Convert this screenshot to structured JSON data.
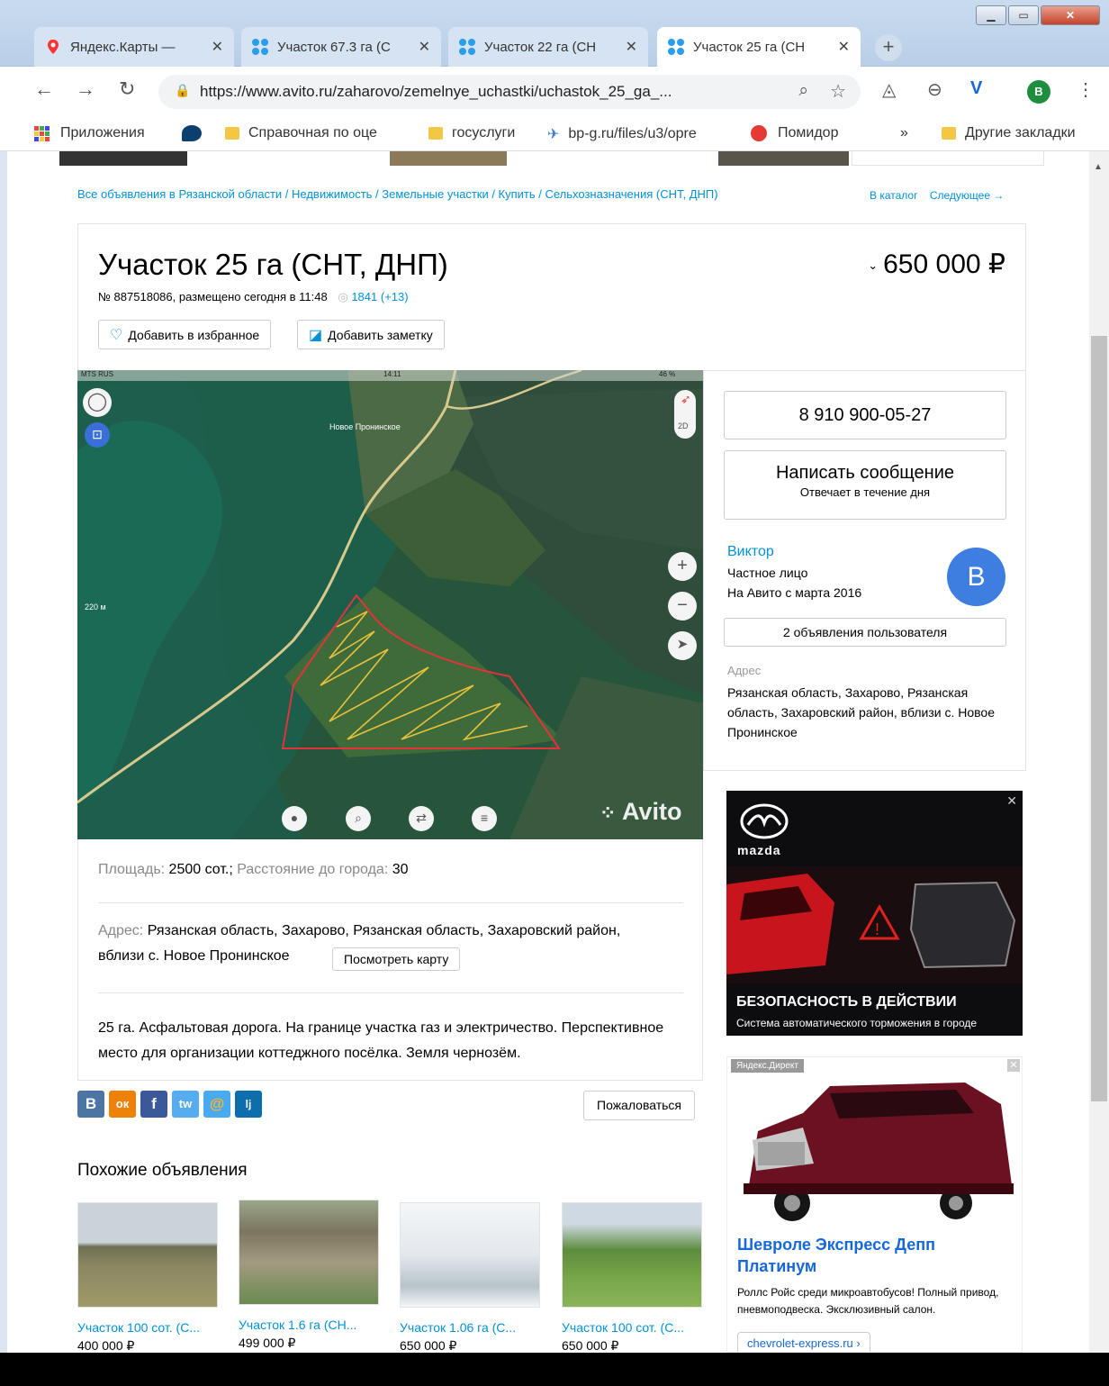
{
  "browser": {
    "tabs": [
      {
        "label": "Яндекс.Карты —",
        "active": false
      },
      {
        "label": "Участок 67.3 га (С",
        "active": false
      },
      {
        "label": "Участок 22 га (СН",
        "active": false
      },
      {
        "label": "Участок 25 га (СН",
        "active": true
      }
    ],
    "url": "https://www.avito.ru/zaharovo/zemelnye_uchastki/uchastok_25_ga_...",
    "profile_initial": "B",
    "bookmarks": [
      {
        "label": "Приложения",
        "icon": "apps-grid-icon"
      },
      {
        "label": "",
        "icon": "bird-icon"
      },
      {
        "label": "Справочная по оце",
        "icon": "folder-icon"
      },
      {
        "label": "госуслуги",
        "icon": "folder-icon"
      },
      {
        "label": "bp-g.ru/files/u3/opre",
        "icon": "plane-icon"
      },
      {
        "label": "Помидор",
        "icon": "red-circle-icon"
      }
    ],
    "bookmarks_more": "»",
    "other_bookmarks": "Другие закладки"
  },
  "page": {
    "breadcrumbs": "Все объявления в Рязанской области / Недвижимость / Земельные участки / Купить / Сельхозназначения (СНТ, ДНП)",
    "catalog_link": "В каталог",
    "next_link": "Следующее →",
    "title": "Участок 25 га (СНТ, ДНП)",
    "price": "650 000 ₽",
    "meta": "№ 887518086, размещено сегодня в 11:48",
    "views": "1841 (+13)",
    "fav_button": "Добавить в избранное",
    "note_button": "Добавить заметку",
    "map": {
      "status_left": "MTS RUS",
      "status_time": "14:11",
      "status_battery": "46 %",
      "village_label": "Новое Пронинское",
      "scale_label": "220 м",
      "mode_label": "2D",
      "watermark": "Avito"
    },
    "details": {
      "area_label": "Площадь:",
      "area_value": "2500 сот.;",
      "dist_label": "Расстояние до города:",
      "dist_value": "30",
      "addr_label": "Адрес:",
      "addr_value": "Рязанская область, Захарово, Рязанская область, Захаровский район,",
      "addr_value2": "вблизи с. Новое Пронинское",
      "map_button": "Посмотреть карту",
      "description": "25 га. Асфальтовая дорога. На границе участка газ и электричество. Перспективное место для организации коттеджного посёлка. Земля чернозём."
    },
    "social": [
      "В",
      "ок",
      "f",
      "tw",
      "@",
      "lj"
    ],
    "complain_button": "Пожаловаться",
    "similar_heading": "Похожие объявления",
    "similar": [
      {
        "title": "Участок 100 сот. (С...",
        "price": "400 000 ₽"
      },
      {
        "title": "Участок 1.6 га (СН...",
        "price": "499 000 ₽"
      },
      {
        "title": "Участок 1.06 га (С...",
        "price": "650 000 ₽"
      },
      {
        "title": "Участок 100 сот. (С...",
        "price": "650 000 ₽"
      }
    ],
    "contact": {
      "phone": "8 910 900-05-27",
      "message_button": "Написать сообщение",
      "message_sub": "Отвечает в течение дня",
      "seller_name": "Виктор",
      "seller_type": "Частное лицо",
      "seller_since": "На Авито с марта 2016",
      "avatar_letter": "В",
      "ads_button": "2 объявления пользователя",
      "address_label": "Адрес",
      "address_value": "Рязанская область, Захарово, Рязанская область, Захаровский район, вблизи с. Новое Пронинское"
    },
    "ad_mazda": {
      "brand": "mazda",
      "headline": "БЕЗОПАСНОСТЬ В ДЕЙСТВИИ",
      "sub": "Система автоматического торможения в городе"
    },
    "ad_chevrolet": {
      "badge": "Яндекс.Директ",
      "headline": "Шевроле Экспресс Депп Платинум",
      "text": "Роллс Ройс среди микроавтобусов! Полный привод, пневмоподвеска. Эксклюзивный салон.",
      "url": "chevrolet-express.ru ›"
    }
  }
}
